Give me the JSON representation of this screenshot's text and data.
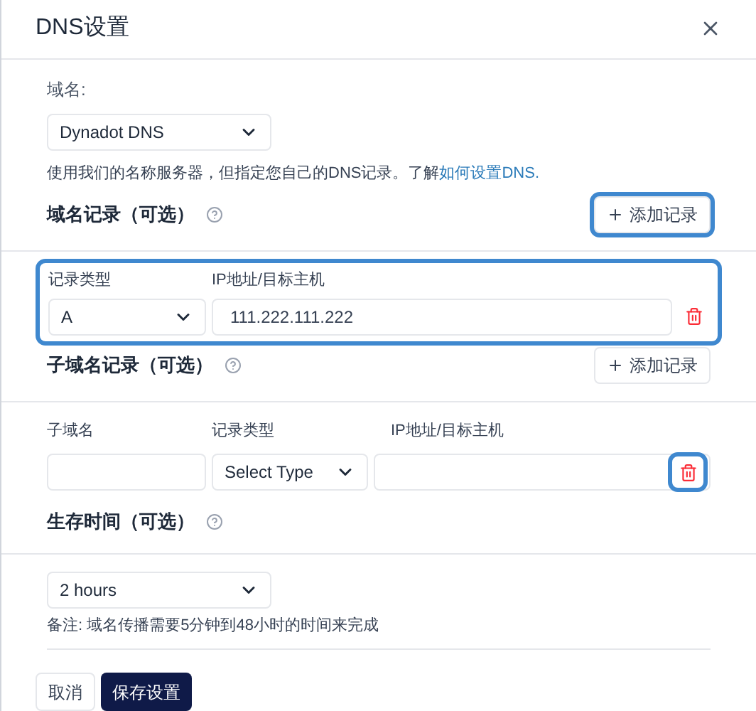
{
  "dialog": {
    "title": "DNS设置"
  },
  "domain": {
    "label": "域名:",
    "select": {
      "value": "Dynadot DNS"
    },
    "help": "使用我们的名称服务器，但指定您自己的DNS记录。了解",
    "help_link": "如何设置DNS."
  },
  "domain_records": {
    "heading": "域名记录（可选）",
    "add_button": {
      "label": "添加记录",
      "highlighted": true
    },
    "columns": [
      "记录类型",
      "IP地址/目标主机"
    ],
    "highlighted": true,
    "rows": [
      {
        "type": "A",
        "value": "111.222.111.222",
        "delete_highlighted": false
      }
    ]
  },
  "subdomain_records": {
    "heading": "子域名记录（可选）",
    "add_button": {
      "label": "添加记录",
      "highlighted": false
    },
    "columns": [
      "子域名",
      "记录类型",
      "IP地址/目标主机"
    ],
    "rows": [
      {
        "type_placeholder": "Select Type",
        "delete_highlighted": true
      }
    ]
  },
  "ttl": {
    "heading": "生存时间（可选）",
    "select": {
      "value": "2 hours"
    },
    "note": "备注: 域名传播需要5分钟到48小时的时间来完成"
  },
  "footer": {
    "buttons": [
      {
        "label": "取消",
        "kind": "secondary"
      },
      {
        "label": "保存设置",
        "kind": "primary"
      }
    ]
  }
}
